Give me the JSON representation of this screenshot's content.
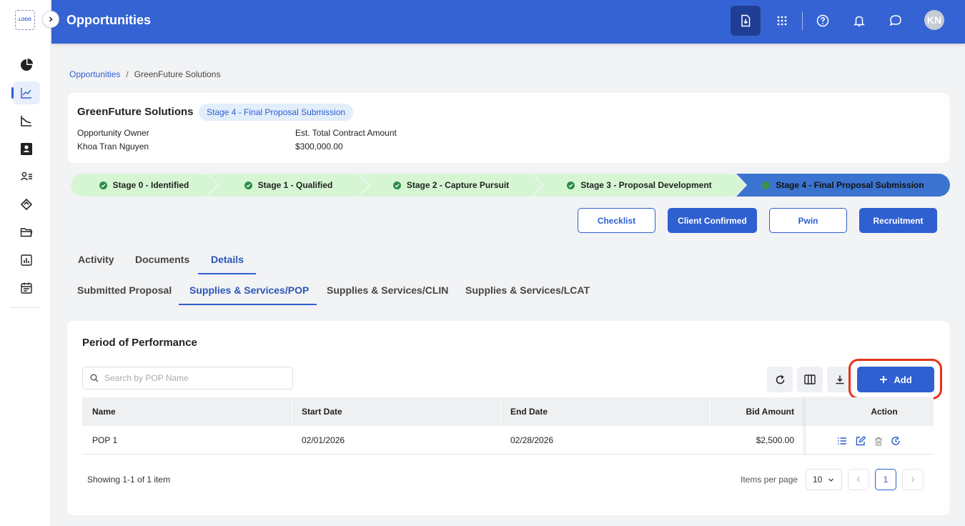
{
  "sidebar": {
    "logo_text": "LOGO",
    "items": [
      {
        "icon": "pie-chart-icon"
      },
      {
        "icon": "line-chart-icon",
        "active": true
      },
      {
        "icon": "trend-chart-icon"
      },
      {
        "icon": "contacts-icon"
      },
      {
        "icon": "people-list-icon"
      },
      {
        "icon": "handshake-icon"
      },
      {
        "icon": "folder-icon"
      },
      {
        "icon": "report-icon"
      },
      {
        "icon": "calendar-icon"
      }
    ]
  },
  "header": {
    "title": "Opportunities",
    "avatar_initials": "KN",
    "brand_color": "#3563d3"
  },
  "breadcrumb": {
    "parent": "Opportunities",
    "separator": "/",
    "current": "GreenFuture Solutions"
  },
  "opportunity": {
    "name": "GreenFuture Solutions",
    "stage_badge": "Stage 4 - Final Proposal Submission",
    "owner_label": "Opportunity Owner",
    "owner_value": "Khoa Tran Nguyen",
    "amount_label": "Est. Total Contract Amount",
    "amount_value": "$300,000.00"
  },
  "stages": [
    {
      "label": "Stage 0 - Identified",
      "status": "done"
    },
    {
      "label": "Stage 1 - Qualified",
      "status": "done"
    },
    {
      "label": "Stage 2 - Capture Pursuit",
      "status": "done"
    },
    {
      "label": "Stage 3 - Proposal Development",
      "status": "done"
    },
    {
      "label": "Stage 4 - Final Proposal Submission",
      "status": "current"
    }
  ],
  "actions": {
    "checklist": "Checklist",
    "client_confirmed": "Client Confirmed",
    "pwin": "Pwin",
    "recruitment": "Recruitment"
  },
  "tabs": {
    "activity": "Activity",
    "documents": "Documents",
    "details": "Details"
  },
  "subtabs": {
    "submitted_proposal": "Submitted Proposal",
    "pop": "Supplies & Services/POP",
    "clin": "Supplies & Services/CLIN",
    "lcat": "Supplies & Services/LCAT"
  },
  "pop_table": {
    "title": "Period of Performance",
    "search_placeholder": "Search by POP Name",
    "add_label": "Add",
    "columns": {
      "name": "Name",
      "start_date": "Start Date",
      "end_date": "End Date",
      "bid_amount": "Bid Amount",
      "action": "Action"
    },
    "rows": [
      {
        "name": "POP 1",
        "start_date": "02/01/2026",
        "end_date": "02/28/2026",
        "bid_amount": "$2,500.00"
      }
    ],
    "footer": {
      "showing": "Showing 1-1 of 1 item",
      "items_per_page_label": "Items per page",
      "items_per_page": "10",
      "current_page": "1"
    }
  }
}
